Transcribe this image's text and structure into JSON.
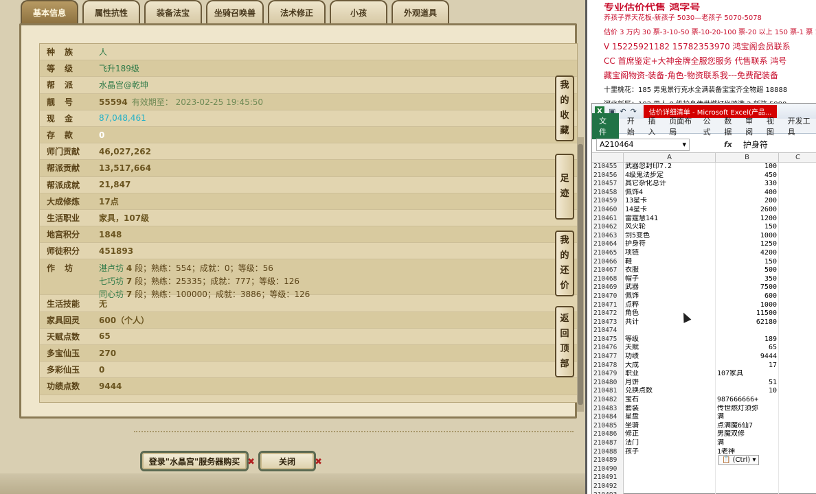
{
  "game": {
    "tabs": [
      {
        "label": "基本信息",
        "active": true
      },
      {
        "label": "属性抗性",
        "active": false
      },
      {
        "label": "装备法宝",
        "active": false
      },
      {
        "label": "坐骑召唤兽",
        "active": false
      },
      {
        "label": "法术修正",
        "active": false
      },
      {
        "label": "小孩",
        "active": false
      },
      {
        "label": "外观道具",
        "active": false
      }
    ],
    "rows": [
      {
        "key": "种族",
        "value": "人",
        "style": "green",
        "spread": true
      },
      {
        "key": "等级",
        "value": "飞升189级",
        "style": "green",
        "spread": true
      },
      {
        "key": "帮派",
        "value": "水晶宫@乾坤",
        "style": "green",
        "spread": true
      },
      {
        "key": "靓号",
        "value": "55594",
        "sub": "有效期至： 2023-02-25 19:45:50",
        "spread": true
      },
      {
        "key": "现金",
        "value": "87,048,461",
        "style": "cyan",
        "spread": true
      },
      {
        "key": "存款",
        "value": "0",
        "style": "white",
        "spread": true
      },
      {
        "key": "师门贡献",
        "value": "46,027,262"
      },
      {
        "key": "帮派贡献",
        "value": "13,517,664"
      },
      {
        "key": "帮派成就",
        "value": "21,847"
      },
      {
        "key": "大成修炼",
        "value": "17点"
      },
      {
        "key": "生活职业",
        "value": "家具，107级"
      },
      {
        "key": "地宫积分",
        "value": "1848"
      },
      {
        "key": "师徒积分",
        "value": "451893"
      }
    ],
    "workshop_key": "作坊",
    "workshops": [
      {
        "name": "湛卢坊",
        "level": "4",
        "text": "段；熟练：554；成就：0；等级：56"
      },
      {
        "name": "七巧坊",
        "level": "7",
        "text": "段；熟练：25335；成就：777；等级：126"
      },
      {
        "name": "同心坊",
        "level": "7",
        "text": "段；熟练：100000；成就：3886；等级：126"
      }
    ],
    "rows2": [
      {
        "key": "生活技能",
        "value": "无"
      },
      {
        "key": "家具回灵",
        "value": "600（个人）"
      },
      {
        "key": "天赋点数",
        "value": "65"
      },
      {
        "key": "多宝仙玉",
        "value": "270"
      },
      {
        "key": "多彩仙玉",
        "value": "0"
      },
      {
        "key": "功绩点数",
        "value": "9444"
      }
    ],
    "side_buttons": [
      {
        "label": "我的收藏",
        "chars": [
          "我",
          "的",
          "收",
          "藏"
        ]
      },
      {
        "label": "足迹",
        "chars": [
          "足",
          "迹"
        ]
      },
      {
        "label": "我的还价",
        "chars": [
          "我",
          "的",
          "还",
          "价"
        ]
      },
      {
        "label": "返回顶部",
        "chars": [
          "返",
          "回",
          "顶",
          "部"
        ]
      }
    ],
    "buy_button": "登录\"水晶宫\"服务器购买",
    "close_button": "关闭"
  },
  "notes": {
    "title": "专业估价代售 鸿字号",
    "lines": [
      {
        "text": "养孩子界天花板-新孩子 5030—老孩子 5070-5078",
        "style": ""
      },
      {
        "text": "估价 3 万内 30 票-3-10-50 票-10-20-100 票-20 以上 150 票-1 票 1",
        "style": ""
      },
      {
        "text": "V 15225921182        15782353970   鸿宝阁会员联系",
        "style": "big"
      },
      {
        "text": "CC 首席鉴定+大神金牌全服您服务 代售联系  鸿号",
        "style": "big"
      },
      {
        "text": "藏宝阁物资-装备-角色-物资联系我---免费配装备",
        "style": "big"
      },
      {
        "text": "十里桃花：185 男鬼景行克水全满装备宝宝齐全物超 18888",
        "style": "black"
      },
      {
        "text": "河北新区：182 男人 8 级护身传世燃灯坐骑满 2 新孩 5880",
        "style": "black"
      }
    ]
  },
  "excel": {
    "window_title": "估价详细清单 - Microsoft Excel(产品...",
    "ribbon_tabs": [
      "开始",
      "插入",
      "页面布局",
      "公式",
      "数据",
      "审阅",
      "视图",
      "开发工具"
    ],
    "file_tab": "文件",
    "name_box": "A210464",
    "formula": "护身符",
    "columns": [
      "A",
      "B",
      "C"
    ],
    "rows": [
      {
        "n": "210455",
        "a": "武器忽封印7.2",
        "b": "100"
      },
      {
        "n": "210456",
        "a": "4级鬼法步定",
        "b": "450"
      },
      {
        "n": "210457",
        "a": "其它杂化总计",
        "b": "330"
      },
      {
        "n": "210458",
        "a": "佩饰4",
        "b": "400"
      },
      {
        "n": "210459",
        "a": "13星卡",
        "b": "200"
      },
      {
        "n": "210460",
        "a": "14星卡",
        "b": "2600"
      },
      {
        "n": "210461",
        "a": "雷霆慧141",
        "b": "1200"
      },
      {
        "n": "210462",
        "a": "风火轮",
        "b": "150"
      },
      {
        "n": "210463",
        "a": "剑5变色",
        "b": "1000"
      },
      {
        "n": "210464",
        "a": "护身符",
        "b": "1250"
      },
      {
        "n": "210465",
        "a": "项链",
        "b": "4200"
      },
      {
        "n": "210466",
        "a": "鞋",
        "b": "150"
      },
      {
        "n": "210467",
        "a": "衣服",
        "b": "500"
      },
      {
        "n": "210468",
        "a": "帽子",
        "b": "350"
      },
      {
        "n": "210469",
        "a": "武器",
        "b": "7500"
      },
      {
        "n": "210470",
        "a": "佩饰",
        "b": "600"
      },
      {
        "n": "210471",
        "a": "点粹",
        "b": "1000"
      },
      {
        "n": "210472",
        "a": "角色",
        "b": "11500"
      },
      {
        "n": "210473",
        "a": "共计",
        "b": "62180"
      },
      {
        "n": "210474",
        "a": "",
        "b": ""
      },
      {
        "n": "210475",
        "a": "等级",
        "b": "189"
      },
      {
        "n": "210476",
        "a": "天赋",
        "b": "65"
      },
      {
        "n": "210477",
        "a": "功绩",
        "b": "9444"
      },
      {
        "n": "210478",
        "a": "大成",
        "b": "17"
      },
      {
        "n": "210479",
        "a": "职业",
        "b": "107家具",
        "left": true
      },
      {
        "n": "210480",
        "a": "月饼",
        "b": "51"
      },
      {
        "n": "210481",
        "a": "兑换点数",
        "b": "10"
      },
      {
        "n": "210482",
        "a": "宝石",
        "b": "987666666+",
        "left": true
      },
      {
        "n": "210483",
        "a": "套装",
        "b": "传世燃灯须弥",
        "left": true
      },
      {
        "n": "210484",
        "a": "星盘",
        "b": "满",
        "left": true
      },
      {
        "n": "210485",
        "a": "坐骑",
        "b": "点满魔6仙7",
        "left": true
      },
      {
        "n": "210486",
        "a": "修正",
        "b": "男魔双修",
        "left": true
      },
      {
        "n": "210487",
        "a": "法门",
        "b": "满",
        "left": true
      },
      {
        "n": "210488",
        "a": "孩子",
        "b": "1老神",
        "left": true
      },
      {
        "n": "210489",
        "a": "",
        "b": ""
      },
      {
        "n": "210490",
        "a": "",
        "b": ""
      },
      {
        "n": "210491",
        "a": "",
        "b": ""
      },
      {
        "n": "210492",
        "a": "",
        "b": ""
      },
      {
        "n": "210493",
        "a": "",
        "b": ""
      }
    ],
    "paste_tag": "(Ctrl)"
  }
}
